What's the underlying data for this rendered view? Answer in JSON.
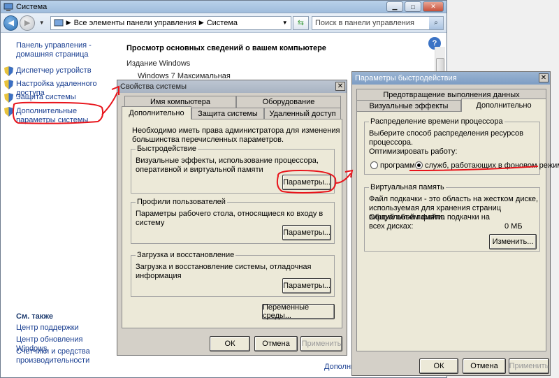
{
  "main": {
    "title": "Система",
    "breadcrumb": {
      "part1": "Все элементы панели управления",
      "part2": "Система"
    },
    "search_placeholder": "Поиск в панели управления",
    "sidebar": {
      "home": "Панель управления - домашняя страница",
      "items": [
        "Диспетчер устройств",
        "Настройка удаленного доступа",
        "Защита системы",
        "Дополнительные параметры системы"
      ],
      "see_also_title": "См. также",
      "see_also": [
        "Центр поддержки",
        "Центр обновления Windows",
        "Счетчики и средства производительности"
      ]
    },
    "content": {
      "heading": "Просмотр основных сведений о вашем компьютере",
      "edition_label": "Издание Windows",
      "edition_value": "Windows 7 Максимальная",
      "bottom_link": "Дополни"
    }
  },
  "sysprops": {
    "title": "Свойства системы",
    "tabs_top": [
      "Имя компьютера",
      "Оборудование"
    ],
    "tabs_bottom": [
      "Дополнительно",
      "Защита системы",
      "Удаленный доступ"
    ],
    "admin_note": "Необходимо иметь права администратора для изменения большинства перечисленных параметров.",
    "performance": {
      "title": "Быстродействие",
      "desc": "Визуальные эффекты, использование процессора, оперативной и виртуальной памяти",
      "button": "Параметры..."
    },
    "profiles": {
      "title": "Профили пользователей",
      "desc": "Параметры рабочего стола, относящиеся ко входу в систему",
      "button": "Параметры..."
    },
    "startup": {
      "title": "Загрузка и восстановление",
      "desc": "Загрузка и восстановление системы, отладочная информация",
      "button": "Параметры..."
    },
    "env_button": "Переменные среды...",
    "ok": "ОК",
    "cancel": "Отмена",
    "apply": "Применить"
  },
  "perf": {
    "title": "Параметры быстродействия",
    "tab_top": "Предотвращение выполнения данных",
    "tabs_bottom": [
      "Визуальные эффекты",
      "Дополнительно"
    ],
    "cpu": {
      "title": "Распределение времени процессора",
      "desc": "Выберите способ распределения ресурсов процессора.",
      "optimize_label": "Оптимизировать работу:",
      "opt_programs": "программ",
      "opt_services": "служб, работающих в фоновом режиме"
    },
    "vm": {
      "title": "Виртуальная память",
      "desc": "Файл подкачки - это область на жестком диске, используемая для хранения страниц виртуальной памяти.",
      "total_label": "Общий объем файла подкачки на всех дисках:",
      "total_value": "0 МБ",
      "change_button": "Изменить..."
    },
    "ok": "ОК",
    "cancel": "Отмена",
    "apply": "Применить"
  },
  "colors": {
    "link": "#1a3f91",
    "annotation": "#e8141b"
  }
}
